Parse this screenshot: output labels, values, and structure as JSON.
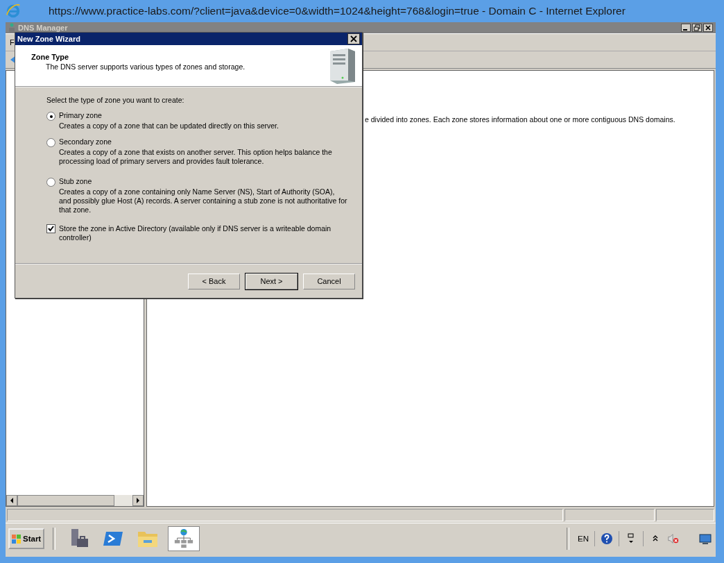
{
  "browser": {
    "title": "https://www.practice-labs.com/?client=java&device=0&width=1024&height=768&login=true - Domain C - Internet Explorer"
  },
  "app": {
    "title": "DNS Manager",
    "menu": [
      "F"
    ],
    "description": "e divided into zones. Each zone stores information about one or more contiguous DNS domains."
  },
  "dialog": {
    "title": "New Zone Wizard",
    "heading": "Zone Type",
    "subheading": "The DNS server supports various types of zones and storage.",
    "prompt": "Select the type of zone you want to create:",
    "options": [
      {
        "label": "Primary zone",
        "description": "Creates a copy of a zone that can be updated directly on this server.",
        "selected": true
      },
      {
        "label": "Secondary zone",
        "description": "Creates a copy of a zone that exists on another server. This option helps balance the processing load of primary servers and provides fault tolerance.",
        "selected": false
      },
      {
        "label": "Stub zone",
        "description": "Creates a copy of a zone containing only Name Server (NS), Start of Authority (SOA), and possibly glue Host (A) records. A server containing a stub zone is not authoritative for that zone.",
        "selected": false
      }
    ],
    "store": {
      "label": "Store the zone in Active Directory (available only if DNS server is a writeable domain controller)",
      "checked": true
    },
    "buttons": [
      {
        "label": "< Back",
        "default": false
      },
      {
        "label": "Next >",
        "default": true
      },
      {
        "label": "Cancel",
        "default": false
      }
    ]
  },
  "taskbar": {
    "start": "Start",
    "language": "EN"
  }
}
